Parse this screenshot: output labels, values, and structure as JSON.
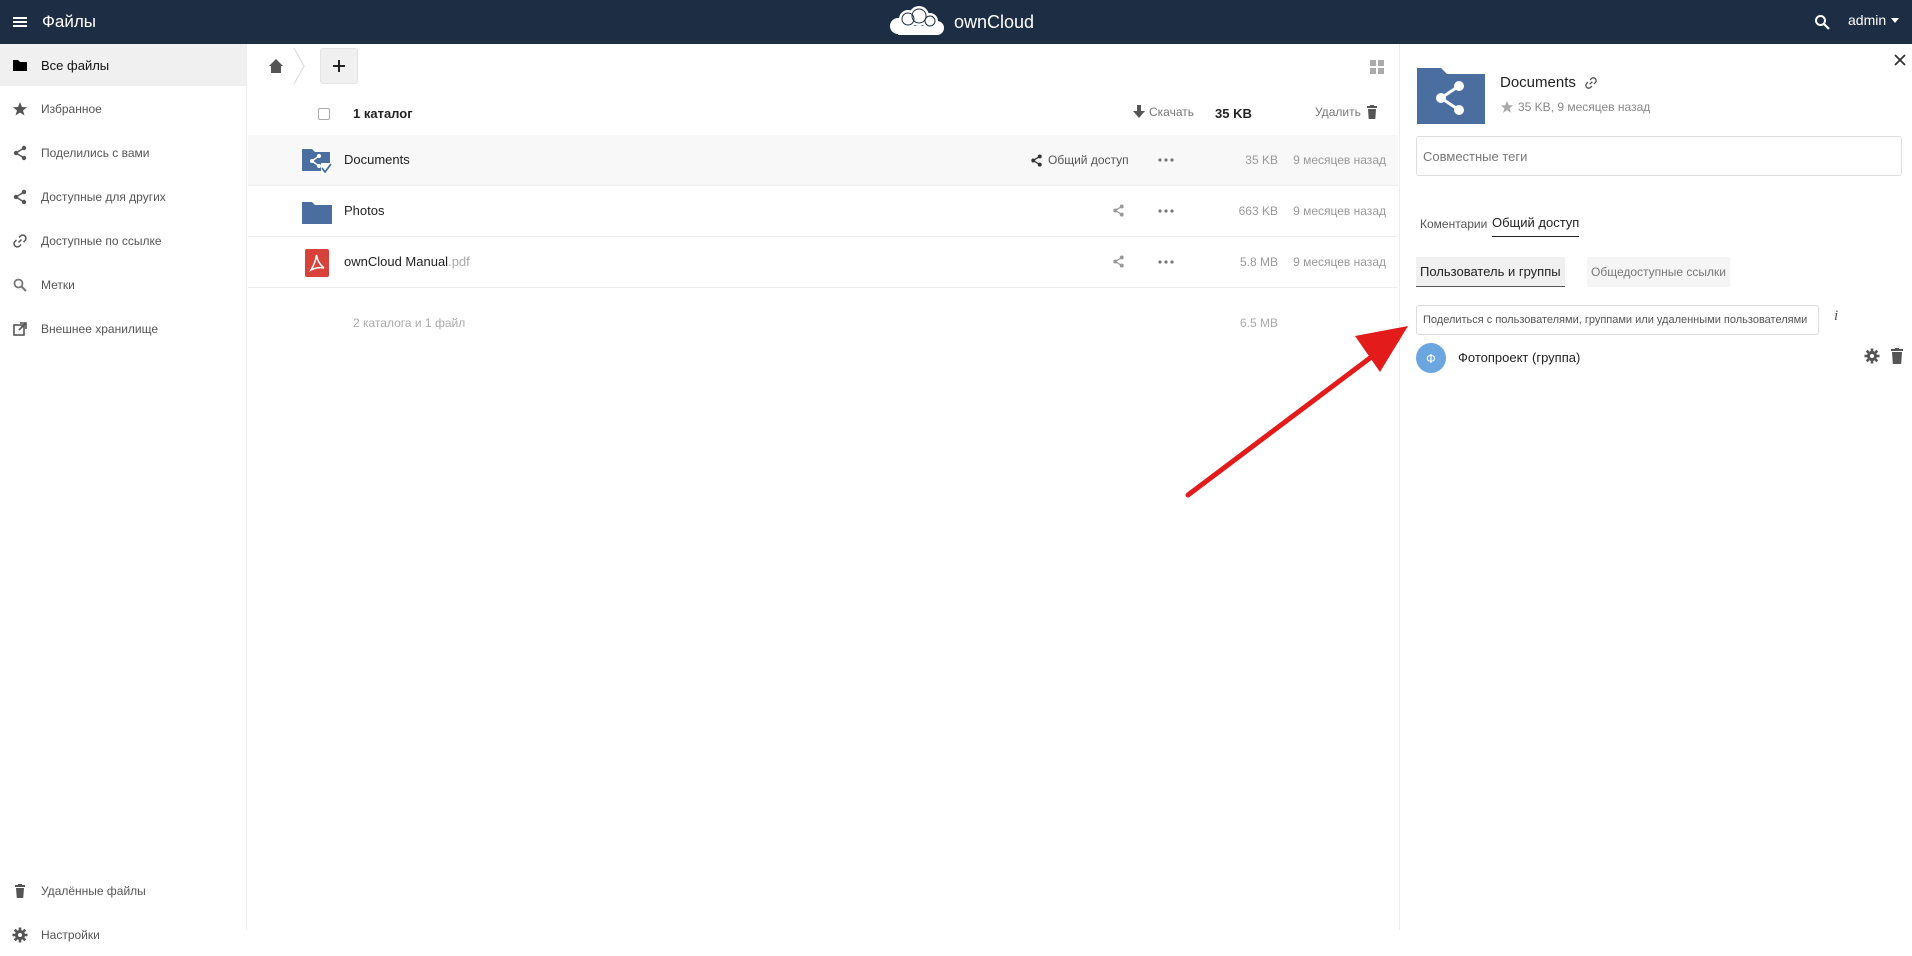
{
  "header": {
    "app_title": "Файлы",
    "logo_text": "ownCloud",
    "user": "admin",
    "bg_color": "#1d2d44"
  },
  "sidebar": {
    "items": [
      {
        "label": "Все файлы",
        "icon": "folder-icon",
        "active": true
      },
      {
        "label": "Избранное",
        "icon": "star-icon"
      },
      {
        "label": "Поделились с вами",
        "icon": "share-icon"
      },
      {
        "label": "Доступные для других",
        "icon": "share-icon"
      },
      {
        "label": "Доступные по ссылке",
        "icon": "link-icon"
      },
      {
        "label": "Метки",
        "icon": "search-icon"
      },
      {
        "label": "Внешнее хранилище",
        "icon": "external-link-icon"
      }
    ],
    "bottom_items": [
      {
        "label": "Удалённые файлы",
        "icon": "trash-icon"
      },
      {
        "label": "Настройки",
        "icon": "gear-icon"
      }
    ]
  },
  "list": {
    "header": {
      "selection_count": "1 каталог",
      "download_label": "Скачать",
      "selection_size": "35 KB",
      "delete_label": "Удалить"
    },
    "rows": [
      {
        "name": "Documents",
        "ext": "",
        "share_label": "Общий доступ",
        "size": "35 KB",
        "date": "9 месяцев назад",
        "type": "shared-folder",
        "selected": true
      },
      {
        "name": "Photos",
        "ext": "",
        "share_label": "",
        "size": "663 KB",
        "date": "9 месяцев назад",
        "type": "folder"
      },
      {
        "name": "ownCloud Manual",
        "ext": ".pdf",
        "share_label": "",
        "size": "5.8 MB",
        "date": "9 месяцев назад",
        "type": "pdf"
      }
    ],
    "summary": {
      "label": "2 каталога и 1 файл",
      "size": "6.5 MB"
    }
  },
  "panel": {
    "title": "Documents",
    "meta": "35 KB, 9 месяцев назад",
    "tags_placeholder": "Совместные теги",
    "tabs": [
      {
        "label": "Коментарии",
        "active": false
      },
      {
        "label": "Общий доступ",
        "active": true
      }
    ],
    "subtabs": [
      {
        "label": "Пользователь и группы",
        "active": true
      },
      {
        "label": "Общедоступные ссылки",
        "active": false
      }
    ],
    "share_input_placeholder": "Поделиться с пользователями, группами или удаленными пользователями",
    "info_label": "i",
    "sharees": [
      {
        "avatar_letter": "Ф",
        "name": "Фотопроект (группа)",
        "avatar_color": "#6ba6e0"
      }
    ]
  },
  "colors": {
    "folder": "#4a6ea0",
    "pdf": "#d9413b",
    "arrow": "#e31b1b"
  }
}
